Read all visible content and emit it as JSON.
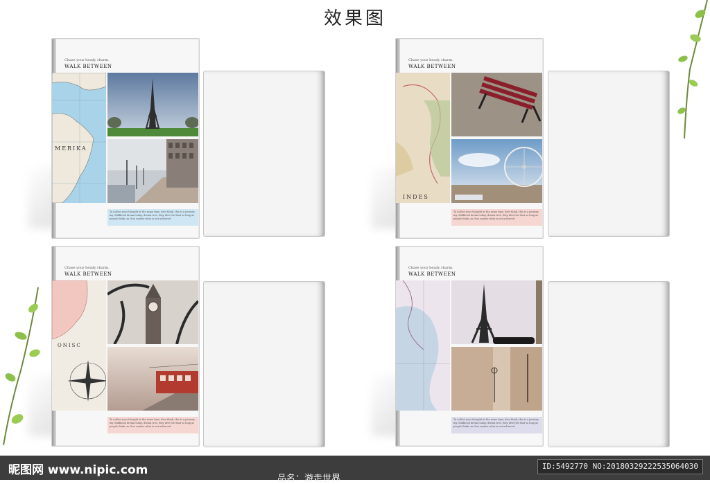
{
  "title": "效果图",
  "covers": [
    {
      "tagline": "Chase your heady charm.",
      "heading": "WALK BETWEEN",
      "text": "To collect your thought at the same time, dive think, this is a journey, my childhood dream today, dream tree, they dive feel that so long as people think, as if no matter what is not achieved.",
      "text_bg": "#cfe6f5"
    },
    {
      "tagline": "Chase your heady charm.",
      "heading": "WALK BETWEEN",
      "text": "To collect your thought at the same time, dive think, this is a journey, my childhood dream today, dream tree, they dive feel that so long as people think, as if no matter what is not achieved.",
      "text_bg": "#f6d6d0"
    },
    {
      "tagline": "Chase your heady charm.",
      "heading": "WALK BETWEEN",
      "text": "To collect your thought at the same time, dive think, this is a journey, my childhood dream today, dream tree, they dive feel that so long as people think, as if no matter what is not achieved.",
      "text_bg": "#f6d6d0"
    },
    {
      "tagline": "Chase your heady charm.",
      "heading": "WALK BETWEEN",
      "text": "To collect your thought at the same time, dive think, this is a journey, my childhood dream today, dream tree, they dive feel that so long as people think, as if no matter what is not achieved.",
      "text_bg": "#dcdcec"
    }
  ],
  "map_labels": [
    "MERIKA",
    "INDES",
    "ONISC"
  ],
  "footer": {
    "logo": "昵图网 www.nipic.com",
    "id_text": "ID:5492770 NO:20180329222535064030",
    "product": "品名：游走世界"
  }
}
